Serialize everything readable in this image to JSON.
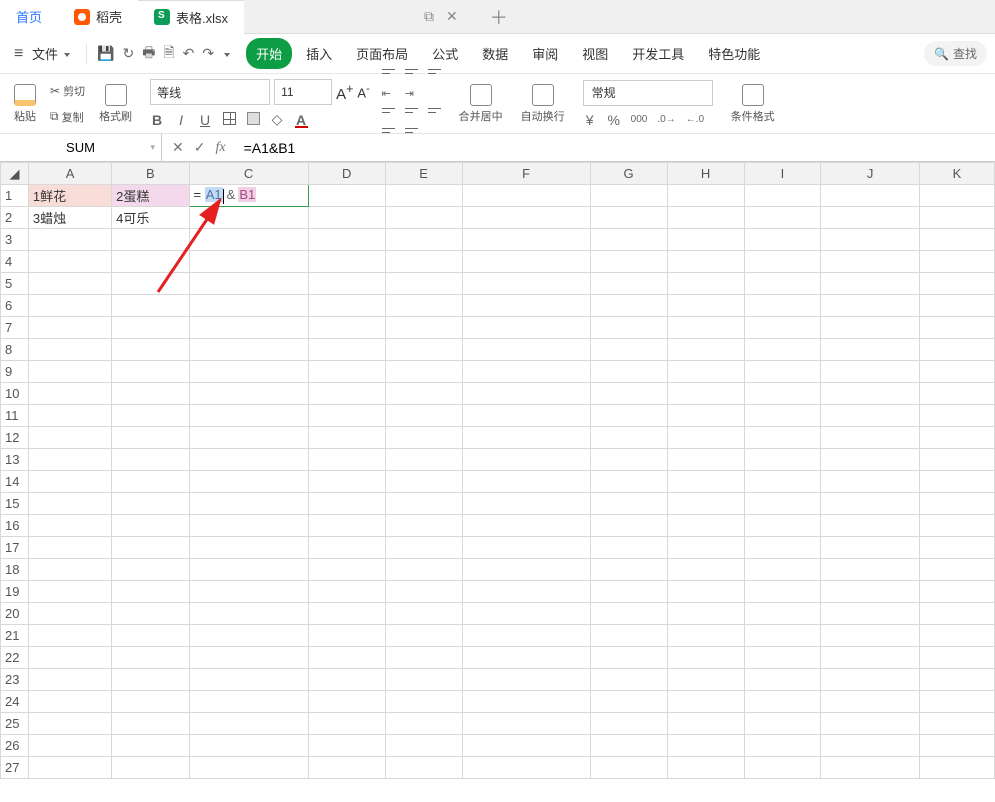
{
  "tabs": {
    "home": "首页",
    "shell": "稻壳",
    "file": "表格.xlsx"
  },
  "fileMenu": "文件",
  "menus": {
    "start": "开始",
    "insert": "插入",
    "pageLayout": "页面布局",
    "formula": "公式",
    "data": "数据",
    "review": "审阅",
    "view": "视图",
    "dev": "开发工具",
    "special": "特色功能"
  },
  "search": {
    "label": "查找"
  },
  "toolbar": {
    "paste": "粘贴",
    "cut": "剪切",
    "copy": "复制",
    "formatPainter": "格式刷",
    "fontName": "等线",
    "fontSize": "11",
    "mergeCenter": "合并居中",
    "wrap": "自动换行",
    "numberFormat": "常规",
    "condFormat": "条件格式"
  },
  "nameBox": "SUM",
  "formulaInput": "=A1&B1",
  "cellEdit": {
    "eq": "=",
    "ref1": "A1",
    "amp": "&",
    "ref2": "B1"
  },
  "cells": {
    "A1": "1鲜花",
    "B1": "2蛋糕",
    "A2": "3蜡烛",
    "B2": "4可乐"
  },
  "cols": [
    "A",
    "B",
    "C",
    "D",
    "E",
    "F",
    "G",
    "H",
    "I",
    "J",
    "K"
  ],
  "rows": 27
}
